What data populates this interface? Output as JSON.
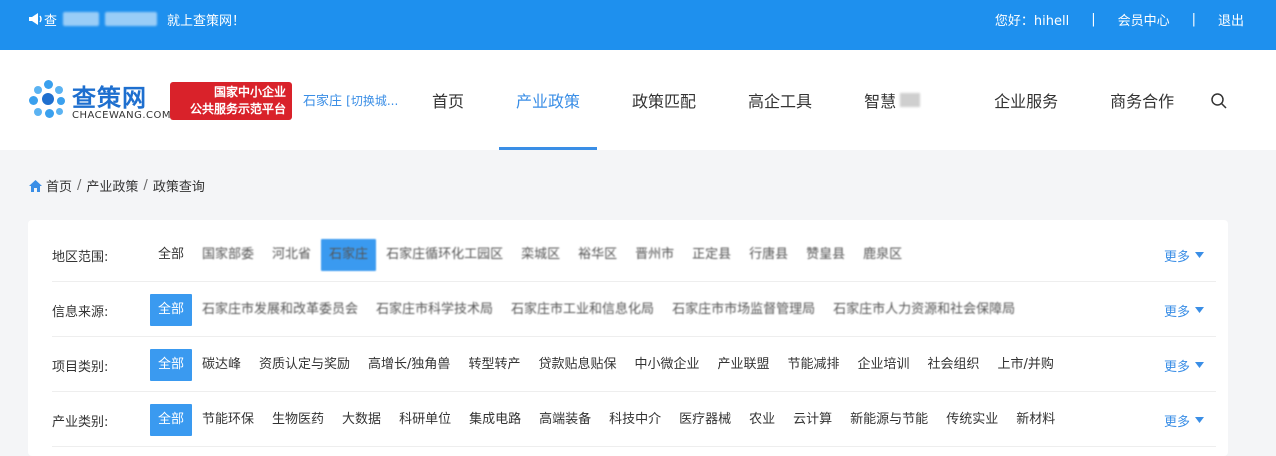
{
  "topbar": {
    "welcome_prefix": "查",
    "welcome_suffix": "就上查策网！",
    "greeting": "您好：hihell",
    "separator": "|",
    "member_center": "会员中心",
    "logout": "退出"
  },
  "header": {
    "logo_brand": "查策网",
    "logo_domain": "CHACEWANG.COM",
    "badge_line1": "国家中小企业",
    "badge_line2": "公共服务示范平台",
    "city": "石家庄",
    "city_switch": "[切换城...",
    "nav": [
      {
        "label": "首页"
      },
      {
        "label": "产业政策"
      },
      {
        "label": "政策匹配"
      },
      {
        "label": "高企工具"
      },
      {
        "label": "智慧"
      },
      {
        "label": "企业服务"
      },
      {
        "label": "商务合作"
      }
    ],
    "search_icon": "search-icon",
    "accent": "#3a8ee6",
    "topbar_color": "#1e90ee",
    "badge_color": "#d9222a"
  },
  "breadcrumb": {
    "home": "首页",
    "sep": "/",
    "level2": "产业政策",
    "level3": "政策查询"
  },
  "filters": {
    "more_label": "更多",
    "rows": [
      {
        "label": "地区范围:",
        "options": [
          "全部",
          "国家部委",
          "河北省",
          "石家庄",
          "石家庄循环化工园区",
          "栾城区",
          "裕华区",
          "晋州市",
          "正定县",
          "行唐县",
          "赞皇县",
          "鹿泉区"
        ]
      },
      {
        "label": "信息来源:",
        "options": [
          "全部",
          "石家庄市发展和改革委员会",
          "石家庄市科学技术局",
          "石家庄市工业和信息化局",
          "石家庄市市场监督管理局",
          "石家庄市人力资源和社会保障局"
        ]
      },
      {
        "label": "项目类别:",
        "options": [
          "全部",
          "碳达峰",
          "资质认定与奖励",
          "高增长/独角兽",
          "转型转产",
          "贷款贴息贴保",
          "中小微企业",
          "产业联盟",
          "节能减排",
          "企业培训",
          "社会组织",
          "上市/并购"
        ]
      },
      {
        "label": "产业类别:",
        "options": [
          "全部",
          "节能环保",
          "生物医药",
          "大数据",
          "科研单位",
          "集成电路",
          "高端装备",
          "科技中介",
          "医疗器械",
          "农业",
          "云计算",
          "新能源与节能",
          "传统实业",
          "新材料"
        ]
      }
    ]
  }
}
